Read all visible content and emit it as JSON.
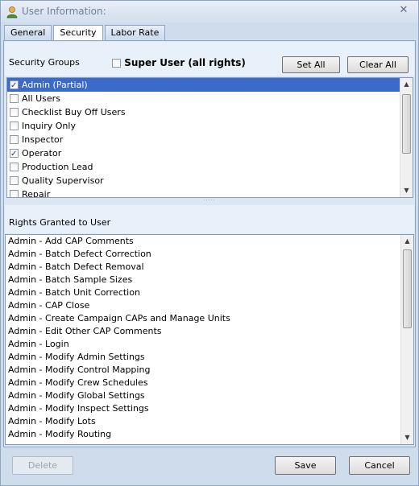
{
  "window": {
    "title": "User Information:"
  },
  "tabs": [
    {
      "label": "General"
    },
    {
      "label": "Security"
    },
    {
      "label": "Labor Rate"
    }
  ],
  "security": {
    "groups_label": "Security Groups",
    "super_user_label": "Super User (all rights)",
    "super_user_checked": false,
    "set_all_label": "Set All",
    "clear_all_label": "Clear All",
    "groups": [
      {
        "label": "Admin (Partial)",
        "checked": true,
        "selected": true
      },
      {
        "label": "All Users",
        "checked": false,
        "selected": false
      },
      {
        "label": "Checklist Buy Off Users",
        "checked": false,
        "selected": false
      },
      {
        "label": "Inquiry Only",
        "checked": false,
        "selected": false
      },
      {
        "label": "Inspector",
        "checked": false,
        "selected": false
      },
      {
        "label": "Operator",
        "checked": true,
        "selected": false
      },
      {
        "label": "Production Lead",
        "checked": false,
        "selected": false
      },
      {
        "label": "Quality Supervisor",
        "checked": false,
        "selected": false
      },
      {
        "label": "Repair",
        "checked": false,
        "selected": false
      }
    ],
    "rights_label": "Rights Granted to User",
    "rights": [
      "Admin - Add CAP Comments",
      "Admin - Batch Defect Correction",
      "Admin - Batch Defect Removal",
      "Admin - Batch Sample Sizes",
      "Admin - Batch Unit Correction",
      "Admin - CAP Close",
      "Admin - Create Campaign CAPs and Manage Units",
      "Admin - Edit Other CAP Comments",
      "Admin - Login",
      "Admin - Modify Admin Settings",
      "Admin - Modify Control Mapping",
      "Admin - Modify Crew Schedules",
      "Admin - Modify Global Settings",
      "Admin - Modify Inspect Settings",
      "Admin - Modify Lots",
      "Admin - Modify Routing"
    ]
  },
  "footer": {
    "delete_label": "Delete",
    "save_label": "Save",
    "cancel_label": "Cancel"
  },
  "colors": {
    "selection": "#3c6ac8",
    "panel": "#dde7f4",
    "frame": "#cfdcec"
  },
  "icons": {
    "title": "user-icon",
    "close": "close-icon"
  }
}
